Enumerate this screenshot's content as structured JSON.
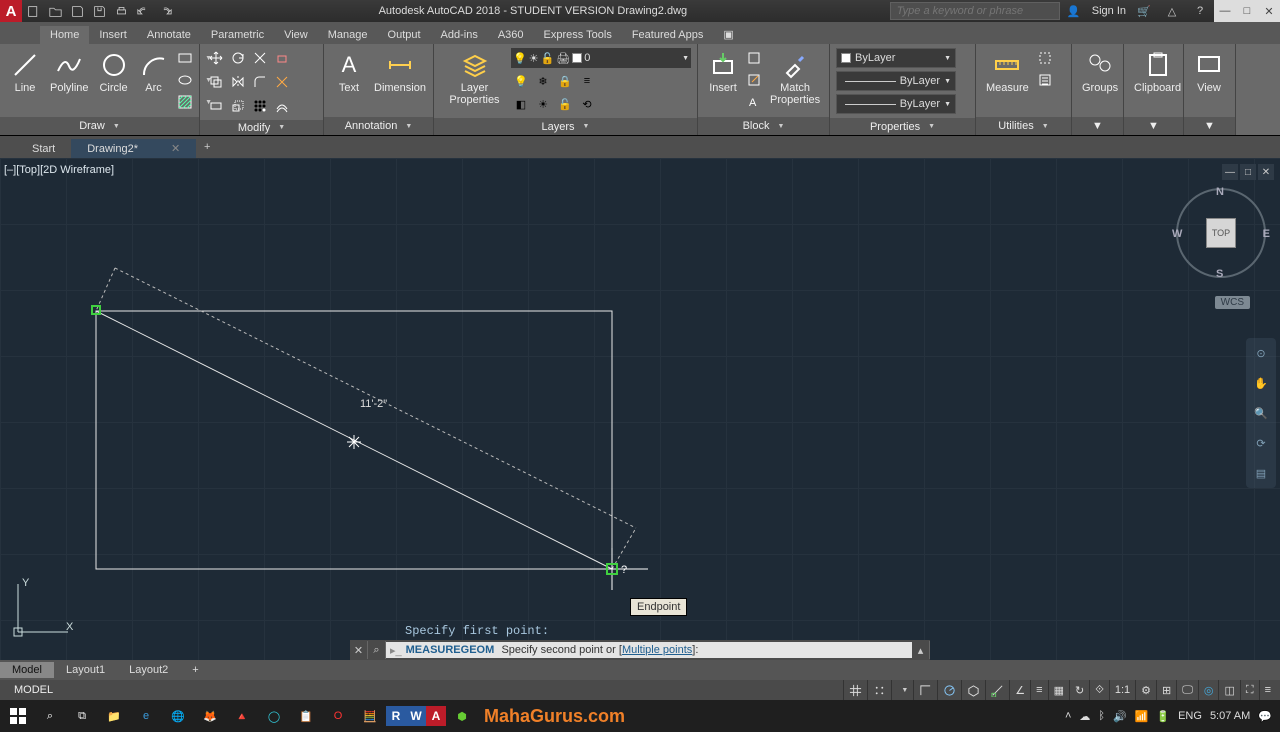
{
  "title": "Autodesk AutoCAD 2018 - STUDENT VERSION   Drawing2.dwg",
  "search_placeholder": "Type a keyword or phrase",
  "signin": "Sign In",
  "tabs": [
    "Home",
    "Insert",
    "Annotate",
    "Parametric",
    "View",
    "Manage",
    "Output",
    "Add-ins",
    "A360",
    "Express Tools",
    "Featured Apps"
  ],
  "active_tab": 0,
  "panels": {
    "draw": {
      "title": "Draw",
      "items": [
        "Line",
        "Polyline",
        "Circle",
        "Arc"
      ]
    },
    "modify": {
      "title": "Modify"
    },
    "annotation": {
      "title": "Annotation",
      "items": [
        "Text",
        "Dimension"
      ]
    },
    "layers": {
      "title": "Layers",
      "item": "Layer Properties",
      "current": "0"
    },
    "block": {
      "title": "Block",
      "items": [
        "Insert",
        "Match Properties"
      ]
    },
    "properties": {
      "title": "Properties",
      "v1": "ByLayer",
      "v2": "ByLayer",
      "v3": "ByLayer"
    },
    "utilities": {
      "title": "Utilities",
      "item": "Measure"
    },
    "groups": {
      "title": "Groups"
    },
    "clipboard": {
      "title": "Clipboard"
    },
    "view": {
      "title": "View"
    }
  },
  "file_tabs": [
    "Start",
    "Drawing2*"
  ],
  "active_file_tab": 1,
  "viewport_label": "[–][Top][2D Wireframe]",
  "dim_text": "11'-2\"",
  "tooltip": "Endpoint",
  "cmd_history": "Specify first point:",
  "cmd_name": "MEASUREGEOM",
  "cmd_prompt": "Specify second point or [",
  "cmd_option": "Multiple points",
  "cmd_end": "]:",
  "model_tabs": [
    "Model",
    "Layout1",
    "Layout2"
  ],
  "viewcube": {
    "top": "TOP",
    "n": "N",
    "s": "S",
    "e": "E",
    "w": "W",
    "wcs": "WCS"
  },
  "status": {
    "model": "MODEL",
    "ratio": "1:1"
  },
  "clock": {
    "t": "5:07 AM"
  },
  "watermark": "MahaGurus.com"
}
